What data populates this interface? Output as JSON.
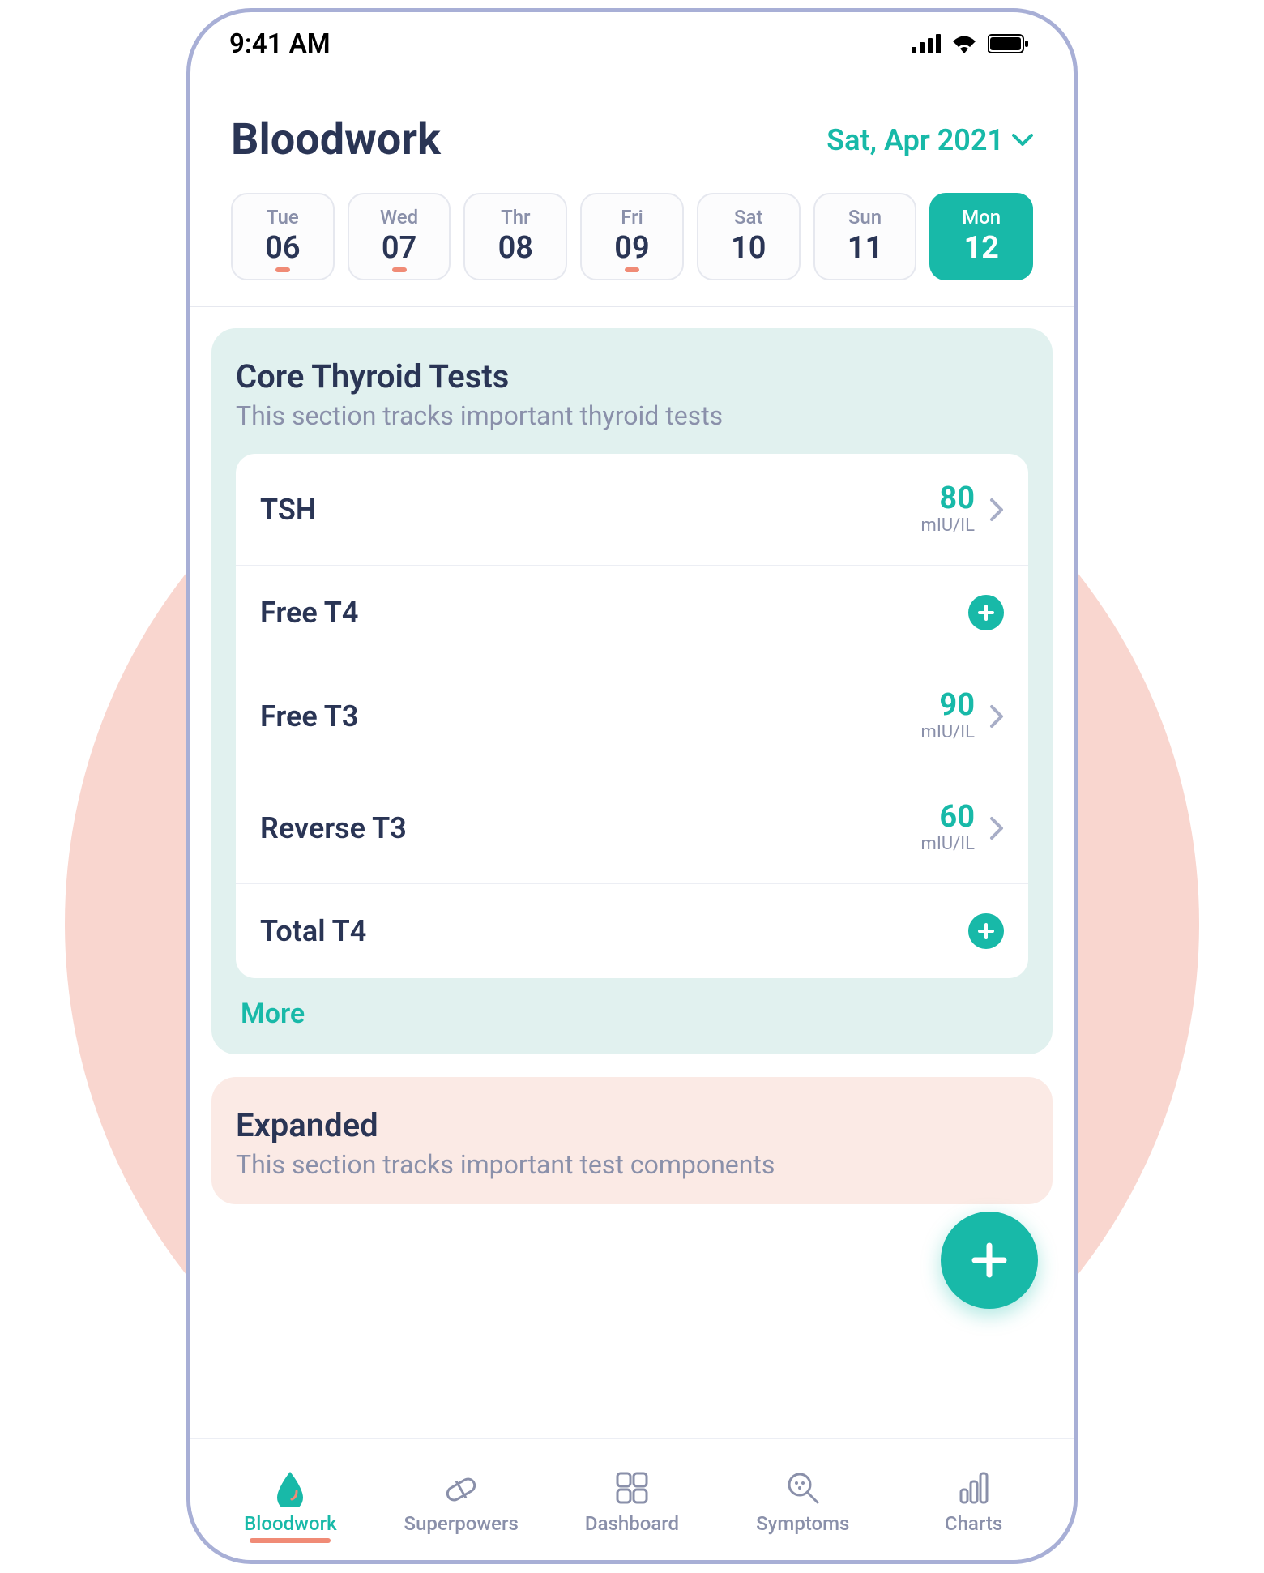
{
  "status": {
    "time": "9:41 AM"
  },
  "header": {
    "title": "Bloodwork",
    "date": "Sat, Apr 2021"
  },
  "days": [
    {
      "name": "Tue",
      "num": "06",
      "dot": true,
      "active": false
    },
    {
      "name": "Wed",
      "num": "07",
      "dot": true,
      "active": false
    },
    {
      "name": "Thr",
      "num": "08",
      "dot": false,
      "active": false
    },
    {
      "name": "Fri",
      "num": "09",
      "dot": true,
      "active": false
    },
    {
      "name": "Sat",
      "num": "10",
      "dot": false,
      "active": false
    },
    {
      "name": "Sun",
      "num": "11",
      "dot": false,
      "active": false
    },
    {
      "name": "Mon",
      "num": "12",
      "dot": false,
      "active": true
    }
  ],
  "card1": {
    "title": "Core Thyroid Tests",
    "sub": "This section tracks important thyroid tests",
    "more": "More",
    "tests": [
      {
        "name": "TSH",
        "value": "80",
        "unit": "mIU/IL",
        "hasValue": true
      },
      {
        "name": "Free T4",
        "hasValue": false
      },
      {
        "name": "Free T3",
        "value": "90",
        "unit": "mIU/IL",
        "hasValue": true
      },
      {
        "name": "Reverse T3",
        "value": "60",
        "unit": "mIU/IL",
        "hasValue": true
      },
      {
        "name": "Total T4",
        "hasValue": false
      }
    ]
  },
  "card2": {
    "title": "Expanded",
    "sub": "This section tracks important test components"
  },
  "tabs": [
    {
      "label": "Bloodwork",
      "icon": "drop",
      "active": true
    },
    {
      "label": "Superpowers",
      "icon": "pill",
      "active": false
    },
    {
      "label": "Dashboard",
      "icon": "grid",
      "active": false
    },
    {
      "label": "Symptoms",
      "icon": "magnify",
      "active": false
    },
    {
      "label": "Charts",
      "icon": "bars",
      "active": false
    }
  ],
  "colors": {
    "teal": "#18b9a8",
    "peach": "#f08b76",
    "navy": "#2a3555",
    "muted": "#8a90aa"
  }
}
